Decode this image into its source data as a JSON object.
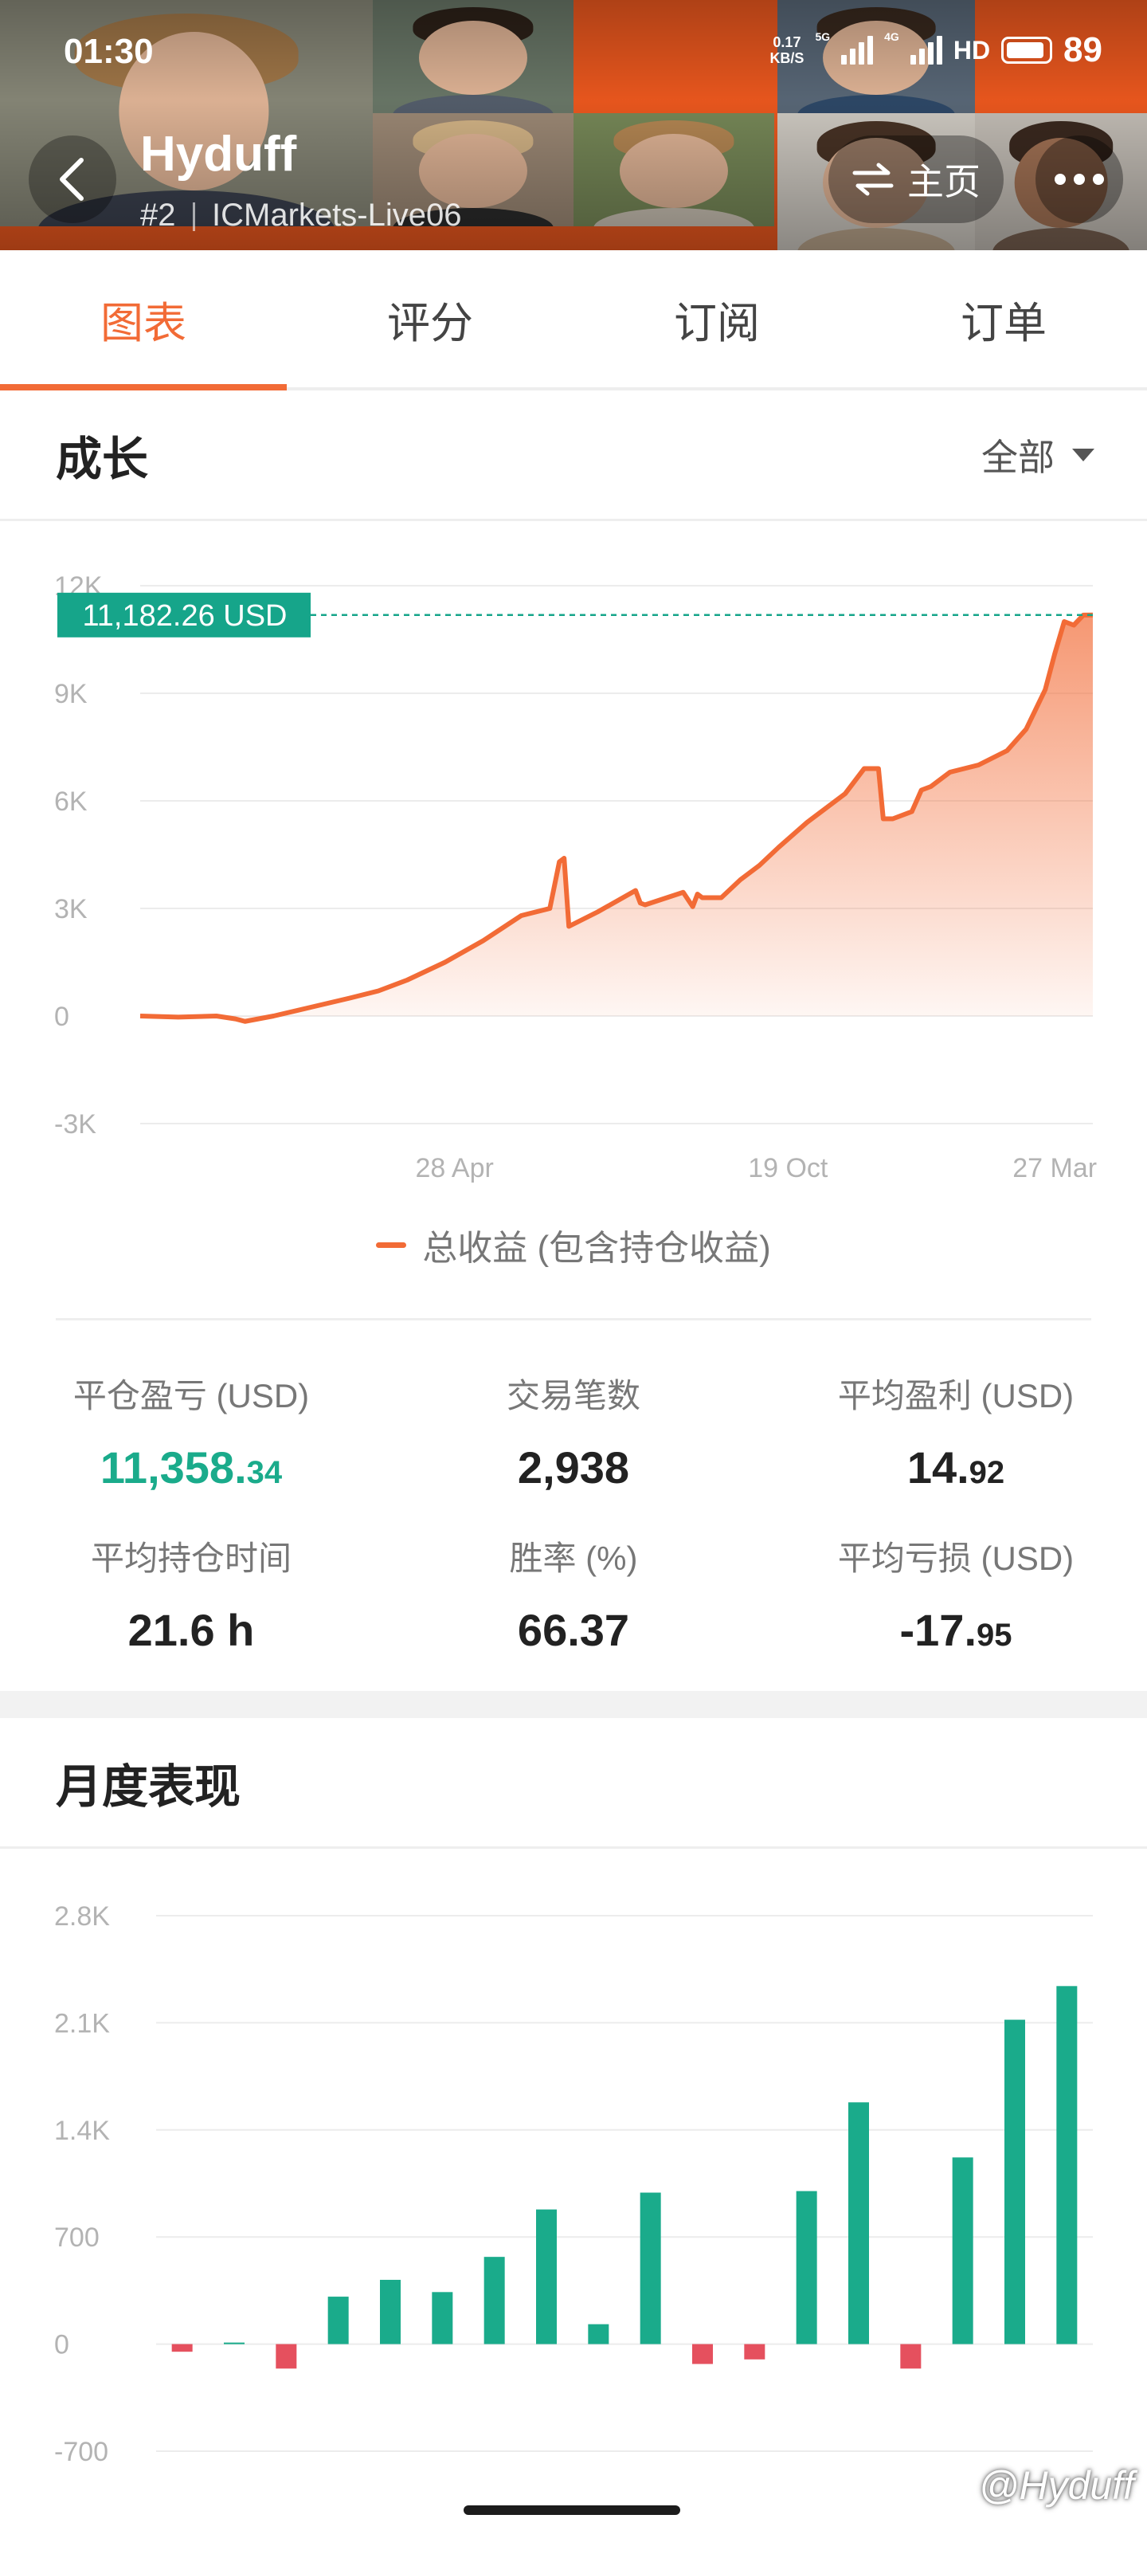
{
  "status_bar": {
    "time": "01:30",
    "net_speed_value": "0.17",
    "net_speed_unit": "KB/S",
    "signal_1_label": "5G",
    "signal_2_label": "4G",
    "hd_label": "HD",
    "battery": "89"
  },
  "header": {
    "trader_name": "Hyduff",
    "rank": "#2",
    "server": "ICMarkets-Live06",
    "home_label": "主页",
    "back_icon": "chevron-left-icon",
    "home_icon": "swap-arrows-icon",
    "more_icon": "more-dots-icon"
  },
  "tabs": [
    {
      "label": "图表",
      "active": true
    },
    {
      "label": "评分",
      "active": false
    },
    {
      "label": "订阅",
      "active": false
    },
    {
      "label": "订单",
      "active": false
    }
  ],
  "growth": {
    "title": "成长",
    "range_label": "全部",
    "current_value_label": "11,182.26 USD",
    "legend": "总收益 (包含持仓收益)"
  },
  "stats": {
    "closed_pnl_label": "平仓盈亏 (USD)",
    "closed_pnl_main": "11,358.",
    "closed_pnl_dec": "34",
    "trades_label": "交易笔数",
    "trades_value": "2,938",
    "avg_profit_label": "平均盈利 (USD)",
    "avg_profit_main": "14.",
    "avg_profit_dec": "92",
    "avg_hold_label": "平均持仓时间",
    "avg_hold_value": "21.6 h",
    "win_rate_label": "胜率 (%)",
    "win_rate_value": "66.37",
    "avg_loss_label": "平均亏损 (USD)",
    "avg_loss_main": "-17.",
    "avg_loss_dec": "95"
  },
  "monthly": {
    "title": "月度表现"
  },
  "watermark": "@Hyduff",
  "colors": {
    "accent": "#f26b36",
    "positive": "#1aab8b",
    "negative": "#e5505e",
    "current_value_tag": "#16a58a"
  },
  "chart_data": [
    {
      "type": "area",
      "name": "growth",
      "x_tick_labels": [
        "28 Apr",
        "19 Oct",
        "27 Mar"
      ],
      "y_tick_labels": [
        "12K",
        "9K",
        "6K",
        "3K",
        "0",
        "-3K"
      ],
      "ylim": [
        -3000,
        12000
      ],
      "grid": true,
      "series": [
        {
          "name": "总收益 (包含持仓收益)",
          "x": [
            0,
            4,
            8,
            10,
            11,
            14,
            18,
            22,
            25,
            28,
            32,
            36,
            40,
            43,
            44,
            44.5,
            45,
            48,
            52,
            52.5,
            53,
            57,
            58,
            58.5,
            59,
            60,
            61,
            63,
            65,
            67,
            70,
            74,
            76,
            77.5,
            78,
            79,
            81,
            82,
            83,
            85,
            88,
            91,
            93,
            95,
            96,
            97,
            98,
            99,
            100
          ],
          "y": [
            0,
            -30,
            0,
            -80,
            -150,
            0,
            250,
            500,
            700,
            1000,
            1500,
            2100,
            2800,
            3000,
            4300,
            4400,
            2500,
            2900,
            3500,
            3150,
            3100,
            3450,
            3050,
            3400,
            3300,
            3300,
            3300,
            3800,
            4200,
            4700,
            5400,
            6200,
            6900,
            6900,
            5500,
            5500,
            5700,
            6300,
            6400,
            6800,
            7000,
            7400,
            8000,
            9100,
            10100,
            11000,
            10900,
            11180,
            11182
          ]
        }
      ]
    },
    {
      "type": "bar",
      "name": "monthly",
      "y_tick_labels": [
        "2.8K",
        "2.1K",
        "1.4K",
        "700",
        "0",
        "-700"
      ],
      "ylim": [
        -700,
        2800
      ],
      "grid": true,
      "values": [
        -50,
        10,
        -160,
        310,
        420,
        340,
        570,
        880,
        130,
        990,
        -130,
        -100,
        1000,
        1580,
        -160,
        1220,
        2120,
        2340
      ]
    }
  ]
}
